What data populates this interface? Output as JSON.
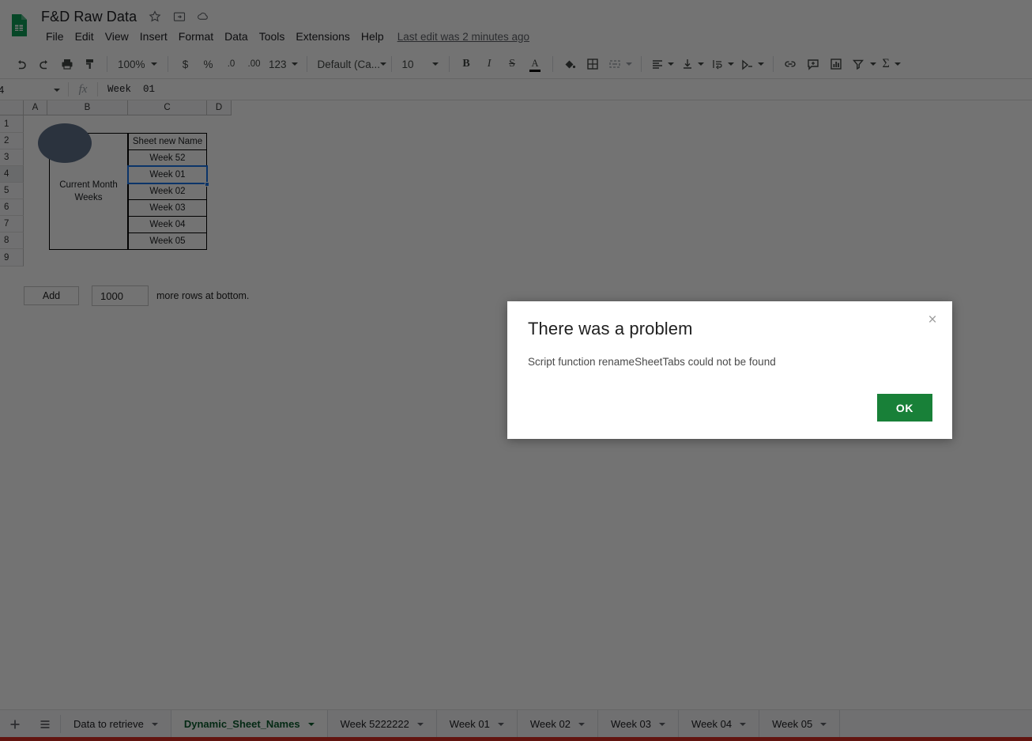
{
  "app": {
    "product_icon": "sheets-logo-icon",
    "doc_title": "F&D Raw Data",
    "title_icons": [
      {
        "name": "star-icon",
        "glyph": "☆"
      },
      {
        "name": "move-to-folder-icon",
        "glyph": "❐"
      },
      {
        "name": "cloud-saved-icon",
        "glyph": "☁"
      }
    ],
    "menus": [
      "File",
      "Edit",
      "View",
      "Insert",
      "Format",
      "Data",
      "Tools",
      "Extensions",
      "Help"
    ],
    "last_edit": "Last edit was 2 minutes ago"
  },
  "toolbar": {
    "undo": "undo-icon",
    "redo": "redo-icon",
    "print": "print-icon",
    "paint_format": "paint-format-icon",
    "zoom_value": "100%",
    "currency": "$",
    "percent": "%",
    "decrease_decimal": ".0",
    "increase_decimal": ".00",
    "more_formats": "123",
    "font_value": "Default (Ca...",
    "font_size_value": "10",
    "bold": "B",
    "italic": "I",
    "strikethrough": "S",
    "text_color": "A",
    "text_color_hex": "#000000",
    "fill_color": "fill-color-icon",
    "borders": "borders-icon",
    "merge_cells": "merge-cells-icon",
    "horizontal_align": "horizontal-align-icon",
    "vertical_align": "vertical-align-icon",
    "text_wrap": "text-wrapping-icon",
    "text_rotation": "text-rotation-icon",
    "insert_link": "insert-link-icon",
    "insert_comment": "insert-comment-icon",
    "insert_chart": "insert-chart-icon",
    "create_filter": "filter-icon",
    "functions": "Σ"
  },
  "formula_bar": {
    "name_box_value": "4",
    "fx_label": "fx",
    "cell_value": "Week  01"
  },
  "grid": {
    "column_headers": [
      "A",
      "B",
      "C",
      "D"
    ],
    "row_headers": [
      "1",
      "2",
      "3",
      "4",
      "5",
      "6",
      "7",
      "8",
      "9"
    ],
    "selected_row": "4",
    "selected_cell": "C4",
    "selection_color": "#1a73e8",
    "merged_label": "Current Month Weeks",
    "shape": {
      "name": "oval-shape",
      "color": "#61718a"
    },
    "column_c_values": [
      "Sheet new Name",
      "Week 52",
      "Week 01",
      "Week 02",
      "Week 03",
      "Week 04",
      "Week 05"
    ]
  },
  "add_rows": {
    "button_label": "Add",
    "count_value": "1000",
    "tail_label": "more rows at bottom."
  },
  "sheet_bar": {
    "add_sheet_icon": "add-sheet-icon",
    "all_sheets_icon": "all-sheets-menu-icon",
    "tabs": [
      {
        "label": "Data to retrieve",
        "active": false
      },
      {
        "label": "Dynamic_Sheet_Names",
        "active": true
      },
      {
        "label": "Week 5222222",
        "active": false
      },
      {
        "label": "Week 01",
        "active": false
      },
      {
        "label": "Week 02",
        "active": false
      },
      {
        "label": "Week 03",
        "active": false
      },
      {
        "label": "Week 04",
        "active": false
      },
      {
        "label": "Week 05",
        "active": false
      }
    ],
    "active_tab_color": "#0b5c2e"
  },
  "dialog": {
    "title": "There was a problem",
    "message": "Script function renameSheetTabs could not be found",
    "ok_label": "OK",
    "close_glyph": "×",
    "ok_color": "#188038"
  }
}
